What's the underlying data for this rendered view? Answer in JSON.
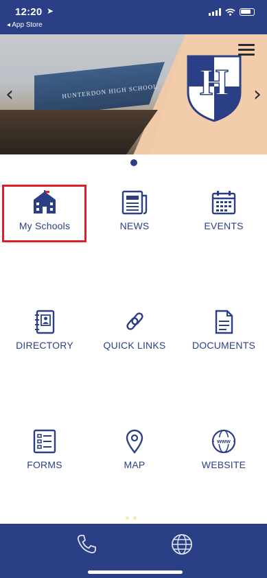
{
  "status_bar": {
    "time": "12:20",
    "back_label": "◂ App Store"
  },
  "banner": {
    "building_text": "HUNTERDON HIGH SCHOOL",
    "crest_letter": "H",
    "colors": {
      "navy": "#2b3f86",
      "peach": "#f3ccab"
    }
  },
  "grid": {
    "items": [
      {
        "label": "My Schools",
        "icon": "school-icon"
      },
      {
        "label": "NEWS",
        "icon": "newspaper-icon"
      },
      {
        "label": "EVENTS",
        "icon": "calendar-icon"
      },
      {
        "label": "DIRECTORY",
        "icon": "contact-book-icon"
      },
      {
        "label": "QUICK LINKS",
        "icon": "link-icon"
      },
      {
        "label": "DOCUMENTS",
        "icon": "document-icon"
      },
      {
        "label": "FORMS",
        "icon": "form-icon"
      },
      {
        "label": "MAP",
        "icon": "map-pin-icon"
      },
      {
        "label": "WEBSITE",
        "icon": "www-globe-icon"
      }
    ]
  },
  "bottom_bar": {
    "phone_icon": "phone-icon",
    "globe_icon": "globe-icon"
  },
  "theme": {
    "accent": "#2b3f86",
    "highlight": "#e11c24"
  }
}
